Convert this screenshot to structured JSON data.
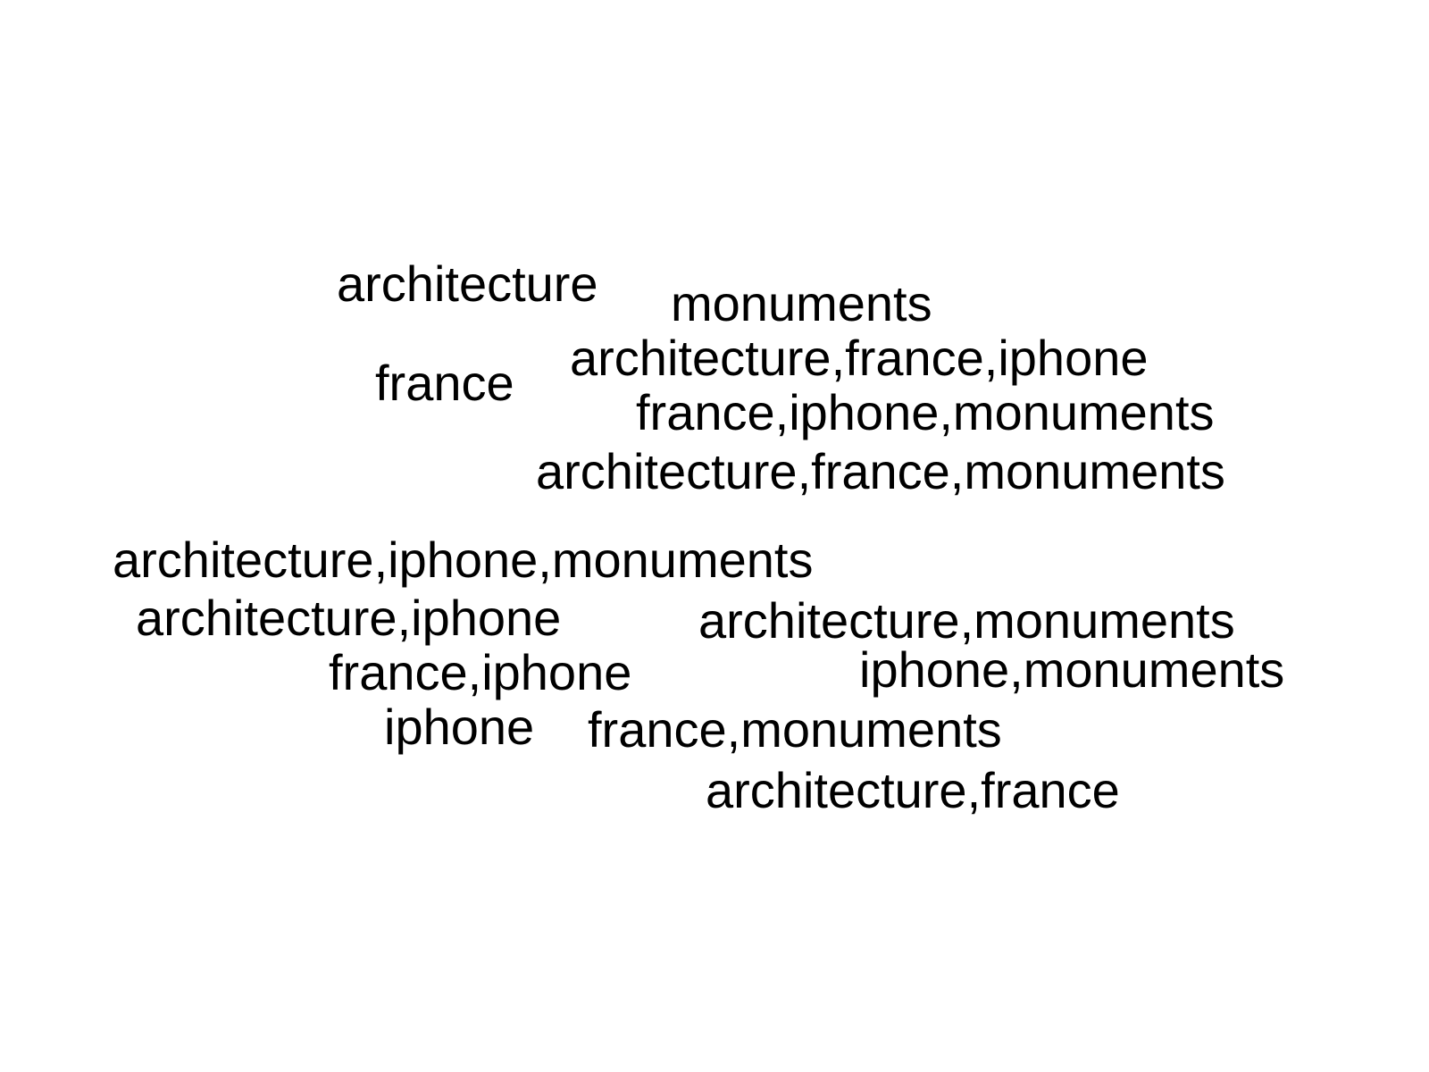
{
  "tag_cloud": {
    "tags": [
      {
        "text": "architecture"
      },
      {
        "text": "monuments"
      },
      {
        "text": "france"
      },
      {
        "text": "architecture,france,iphone"
      },
      {
        "text": "france,iphone,monuments"
      },
      {
        "text": "architecture,france,monuments"
      },
      {
        "text": "architecture,iphone,monuments"
      },
      {
        "text": "architecture,iphone"
      },
      {
        "text": "architecture,monuments"
      },
      {
        "text": "france,iphone"
      },
      {
        "text": "iphone,monuments"
      },
      {
        "text": "iphone"
      },
      {
        "text": "france,monuments"
      },
      {
        "text": "architecture,france"
      }
    ],
    "text_color": "#000000",
    "background_color": "#ffffff"
  }
}
